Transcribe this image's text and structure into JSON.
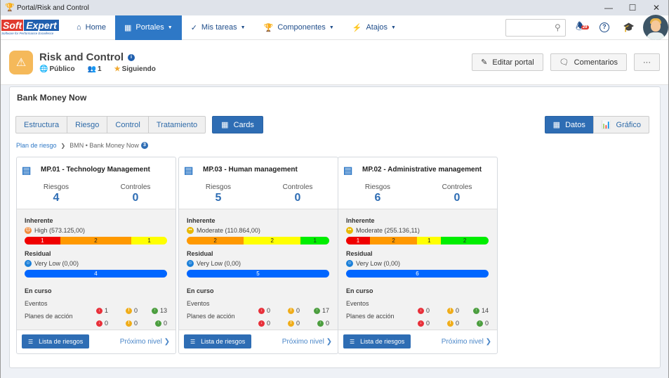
{
  "window": {
    "title": "Portal/Risk and Control",
    "controls": [
      "minimize",
      "maximize",
      "close"
    ]
  },
  "navbar": {
    "logo": {
      "brand_a": "Soft",
      "brand_b": "Expert",
      "tagline": "Software for Performance Excellence"
    },
    "items": [
      {
        "label": "Home",
        "icon": "home-icon",
        "dropdown": false,
        "active": false
      },
      {
        "label": "Portales",
        "icon": "grid-icon",
        "dropdown": true,
        "active": true
      },
      {
        "label": "Mis tareas",
        "icon": "check-icon",
        "dropdown": true,
        "active": false
      },
      {
        "label": "Componentes",
        "icon": "trophy-icon",
        "dropdown": true,
        "active": false
      },
      {
        "label": "Atajos",
        "icon": "bolt-icon",
        "dropdown": true,
        "active": false
      }
    ],
    "search": {
      "value": "",
      "placeholder": ""
    },
    "notifications": {
      "count": "29"
    }
  },
  "header": {
    "title": "Risk and Control",
    "visibility": "Público",
    "members": "1",
    "following": "Siguiendo",
    "buttons": {
      "edit": "Editar portal",
      "comments": "Comentarios",
      "more": "···"
    }
  },
  "panel": {
    "title": "Bank Money Now",
    "tabs": [
      "Estructura",
      "Riesgo",
      "Control",
      "Tratamiento"
    ],
    "cards_tab": "Cards",
    "view_toggle": {
      "data": "Datos",
      "chart": "Gráfico"
    },
    "breadcrumb": {
      "root": "Plan de riesgo",
      "current": "BMN • Bank Money Now",
      "count": "3"
    }
  },
  "labels": {
    "riesgos": "Riesgos",
    "controles": "Controles",
    "inherente": "Inherente",
    "residual": "Residual",
    "en_curso": "En curso",
    "eventos": "Eventos",
    "planes": "Planes de acción",
    "lista": "Lista de riesgos",
    "next": "Próximo nivel"
  },
  "colors": {
    "red": "#f00000",
    "orange": "#ff9900",
    "yellow": "#ffff00",
    "green": "#00ee00",
    "blue": "#0066ff",
    "primary": "#2e6db4"
  },
  "cards": [
    {
      "title": "MP.01 - Technology Management",
      "riesgos": "4",
      "controles": "0",
      "inherent": {
        "level": "High (573.125,00)",
        "face": "sad",
        "segments": [
          {
            "color": "red",
            "value": 1
          },
          {
            "color": "orange",
            "value": 2
          },
          {
            "color": "yellow",
            "value": 1
          }
        ]
      },
      "residual": {
        "level": "Very Low (0,00)",
        "segments": [
          {
            "color": "blue",
            "value": 4
          }
        ]
      },
      "eventos": {
        "red": "1",
        "yellow": "0",
        "green": "13"
      },
      "planes": {
        "red": "0",
        "yellow": "0",
        "green": "0"
      }
    },
    {
      "title": "MP.03 - Human management",
      "riesgos": "5",
      "controles": "0",
      "inherent": {
        "level": "Moderate (110.864,00)",
        "face": "neutral",
        "segments": [
          {
            "color": "orange",
            "value": 2
          },
          {
            "color": "yellow",
            "value": 2
          },
          {
            "color": "green",
            "value": 1
          }
        ]
      },
      "residual": {
        "level": "Very Low (0,00)",
        "segments": [
          {
            "color": "blue",
            "value": 5
          }
        ]
      },
      "eventos": {
        "red": "0",
        "yellow": "0",
        "green": "17"
      },
      "planes": {
        "red": "0",
        "yellow": "0",
        "green": "0"
      }
    },
    {
      "title": "MP.02 - Administrative management",
      "riesgos": "6",
      "controles": "0",
      "inherent": {
        "level": "Moderate (255.136,11)",
        "face": "neutral",
        "segments": [
          {
            "color": "red",
            "value": 1
          },
          {
            "color": "orange",
            "value": 2
          },
          {
            "color": "yellow",
            "value": 1
          },
          {
            "color": "green",
            "value": 2
          }
        ]
      },
      "residual": {
        "level": "Very Low (0,00)",
        "segments": [
          {
            "color": "blue",
            "value": 6
          }
        ]
      },
      "eventos": {
        "red": "0",
        "yellow": "0",
        "green": "14"
      },
      "planes": {
        "red": "0",
        "yellow": "0",
        "green": "0"
      }
    }
  ]
}
